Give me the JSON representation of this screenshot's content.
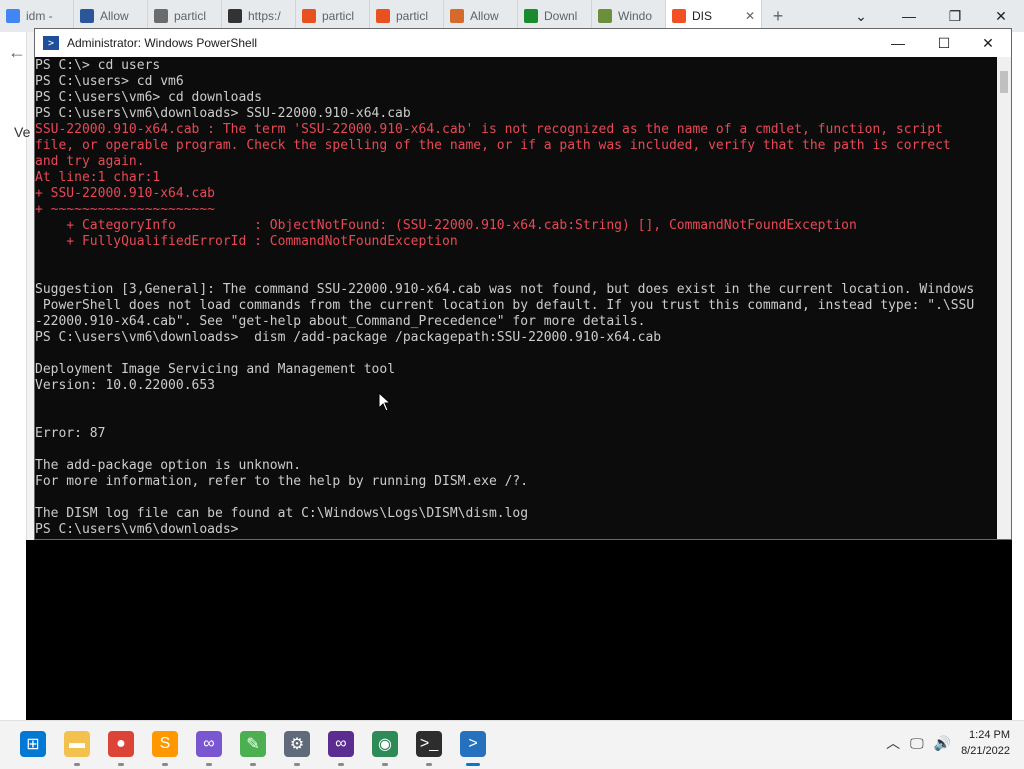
{
  "browser": {
    "tabs": [
      {
        "label": "idm -",
        "color": "#4285f4"
      },
      {
        "label": "Allow",
        "color": "#2b579a"
      },
      {
        "label": "particl",
        "color": "#6b6b6b"
      },
      {
        "label": "https:/",
        "color": "#333333"
      },
      {
        "label": "particl",
        "color": "#e8501f"
      },
      {
        "label": "particl",
        "color": "#e8501f"
      },
      {
        "label": "Allow",
        "color": "#d66a2c"
      },
      {
        "label": "Downl",
        "color": "#1a8a2e"
      },
      {
        "label": "Windo",
        "color": "#6b8f3a"
      },
      {
        "label": "DIS",
        "color": "#f25022",
        "active": true
      }
    ],
    "left_text": "Ve"
  },
  "powershell": {
    "title": "Administrator: Windows PowerShell",
    "lines": [
      {
        "t": "PS C:\\> cd users",
        "c": "white"
      },
      {
        "t": "PS C:\\users> cd vm6",
        "c": "white"
      },
      {
        "t": "PS C:\\users\\vm6> cd downloads",
        "c": "white"
      },
      {
        "t": "PS C:\\users\\vm6\\downloads> SSU-22000.910-x64.cab",
        "c": "white"
      },
      {
        "t": "SSU-22000.910-x64.cab : The term 'SSU-22000.910-x64.cab' is not recognized as the name of a cmdlet, function, script",
        "c": "err"
      },
      {
        "t": "file, or operable program. Check the spelling of the name, or if a path was included, verify that the path is correct",
        "c": "err"
      },
      {
        "t": "and try again.",
        "c": "err"
      },
      {
        "t": "At line:1 char:1",
        "c": "err"
      },
      {
        "t": "+ SSU-22000.910-x64.cab",
        "c": "err"
      },
      {
        "t": "+ ~~~~~~~~~~~~~~~~~~~~~",
        "c": "err"
      },
      {
        "t": "    + CategoryInfo          : ObjectNotFound: (SSU-22000.910-x64.cab:String) [], CommandNotFoundException",
        "c": "err"
      },
      {
        "t": "    + FullyQualifiedErrorId : CommandNotFoundException",
        "c": "err"
      },
      {
        "t": "",
        "c": "white"
      },
      {
        "t": "",
        "c": "white"
      },
      {
        "t": "Suggestion [3,General]: The command SSU-22000.910-x64.cab was not found, but does exist in the current location. Windows",
        "c": "white"
      },
      {
        "t": " PowerShell does not load commands from the current location by default. If you trust this command, instead type: \".\\SSU",
        "c": "white"
      },
      {
        "t": "-22000.910-x64.cab\". See \"get-help about_Command_Precedence\" for more details.",
        "c": "white"
      },
      {
        "t": "PS C:\\users\\vm6\\downloads>  dism /add-package /packagepath:SSU-22000.910-x64.cab",
        "c": "white"
      },
      {
        "t": "",
        "c": "white"
      },
      {
        "t": "Deployment Image Servicing and Management tool",
        "c": "white"
      },
      {
        "t": "Version: 10.0.22000.653",
        "c": "white"
      },
      {
        "t": "",
        "c": "white"
      },
      {
        "t": "",
        "c": "white"
      },
      {
        "t": "Error: 87",
        "c": "white"
      },
      {
        "t": "",
        "c": "white"
      },
      {
        "t": "The add-package option is unknown.",
        "c": "white"
      },
      {
        "t": "For more information, refer to the help by running DISM.exe /?.",
        "c": "white"
      },
      {
        "t": "",
        "c": "white"
      },
      {
        "t": "The DISM log file can be found at C:\\Windows\\Logs\\DISM\\dism.log",
        "c": "white"
      },
      {
        "t": "PS C:\\users\\vm6\\downloads>",
        "c": "white"
      }
    ]
  },
  "taskbar": {
    "apps": [
      {
        "name": "start-button",
        "glyph": "⊞",
        "color": "#0078d4"
      },
      {
        "name": "file-explorer-icon",
        "glyph": "▬",
        "color": "#f2c14e"
      },
      {
        "name": "chrome-icon",
        "glyph": "●",
        "color": "#db4437"
      },
      {
        "name": "sublime-icon",
        "glyph": "S",
        "color": "#ff9800"
      },
      {
        "name": "visual-studio-icon",
        "glyph": "∞",
        "color": "#7a57d1"
      },
      {
        "name": "notepad-icon",
        "glyph": "✎",
        "color": "#4caf50"
      },
      {
        "name": "settings-icon",
        "glyph": "⚙",
        "color": "#5f6b7a"
      },
      {
        "name": "visual-studio-2-icon",
        "glyph": "∞",
        "color": "#5c2d91"
      },
      {
        "name": "network-globe-icon",
        "glyph": "◉",
        "color": "#2e8b57"
      },
      {
        "name": "terminal-icon",
        "glyph": ">_",
        "color": "#2d2d2d"
      },
      {
        "name": "powershell-icon",
        "glyph": ">",
        "color": "#2671be"
      }
    ],
    "time": "1:24 PM",
    "date": "8/21/2022"
  }
}
